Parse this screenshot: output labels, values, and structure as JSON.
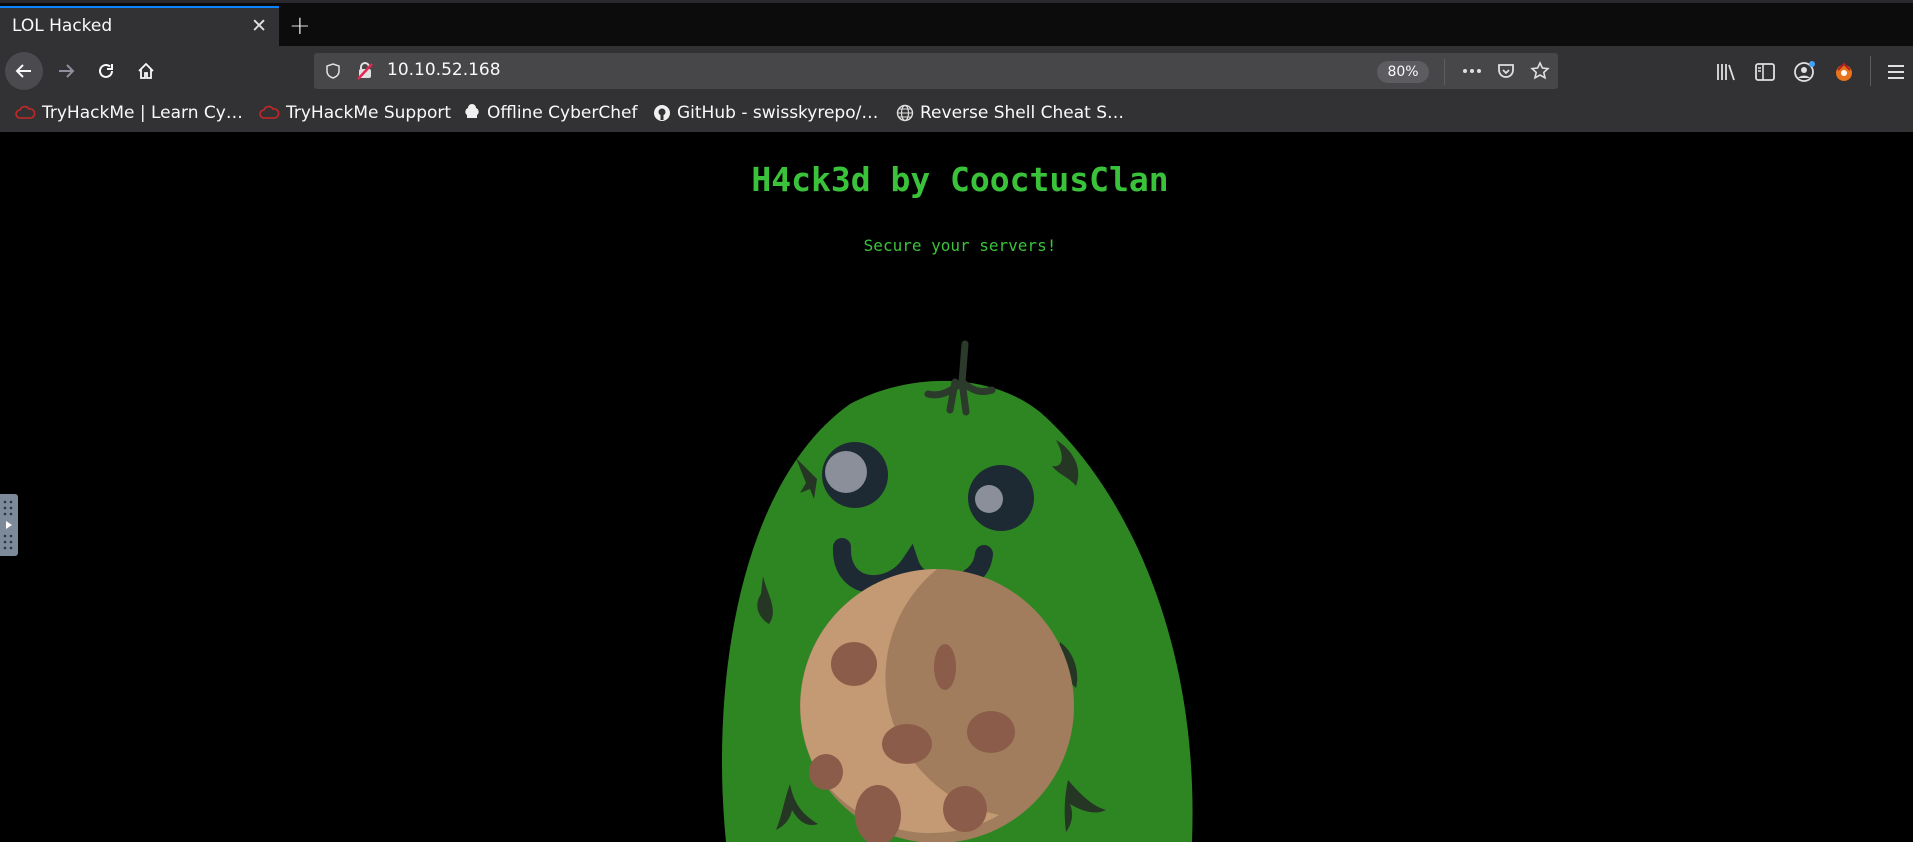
{
  "tab": {
    "title": "LOL Hacked",
    "close": "✕",
    "new": "+"
  },
  "nav": {
    "url": "10.10.52.168",
    "zoom": "80%"
  },
  "bookmarks": [
    {
      "label": "TryHackMe | Learn Cy…"
    },
    {
      "label": "TryHackMe Support"
    },
    {
      "label": "Offline CyberChef"
    },
    {
      "label": "GitHub - swisskyrepo/…"
    },
    {
      "label": "Reverse Shell Cheat S…"
    }
  ],
  "page": {
    "heading": "H4ck3d by CooctusClan",
    "subheading": "Secure your servers!"
  },
  "colors": {
    "accent": "#0a84ff",
    "hack_green": "#3ac33a",
    "cucumber": "#2e8622"
  }
}
